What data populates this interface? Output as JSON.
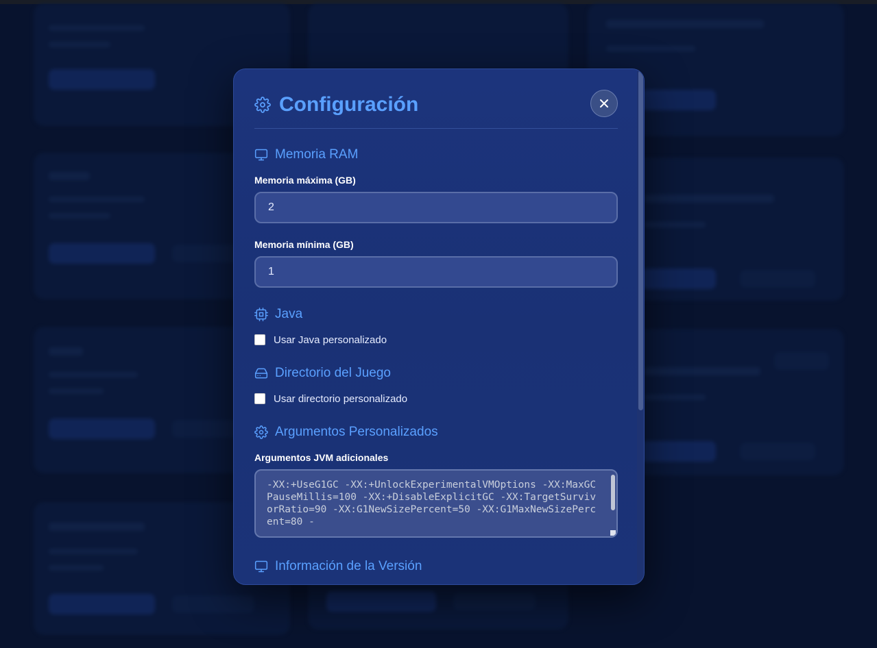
{
  "modal": {
    "title": "Configuración",
    "title_icon": "gear-icon",
    "close_icon": "close-icon"
  },
  "sections": {
    "ram": {
      "title": "Memoria RAM",
      "icon": "monitor-icon"
    },
    "java": {
      "title": "Java",
      "icon": "cpu-icon"
    },
    "gamedir": {
      "title": "Directorio del Juego",
      "icon": "hard-drive-icon"
    },
    "args": {
      "title": "Argumentos Personalizados",
      "icon": "gear-icon"
    },
    "version": {
      "title": "Información de la Versión",
      "icon": "monitor-icon"
    }
  },
  "fields": {
    "max_memory": {
      "label": "Memoria máxima (GB)",
      "value": "2"
    },
    "min_memory": {
      "label": "Memoria mínima (GB)",
      "value": "1"
    },
    "custom_java": {
      "label": "Usar Java personalizado",
      "checked": false
    },
    "custom_dir": {
      "label": "Usar directorio personalizado",
      "checked": false
    },
    "jvm_args": {
      "label": "Argumentos JVM adicionales",
      "value": "-XX:+UseG1GC -XX:+UnlockExperimentalVMOptions -XX:MaxGCPauseMillis=100 -XX:+DisableExplicitGC -XX:TargetSurvivorRatio=90 -XX:G1NewSizePercent=50 -XX:G1MaxNewSizePercent=80 -"
    }
  },
  "colors": {
    "accent": "#5aa0ff",
    "modal_bg": "#1c347c",
    "input_bg": "#334990",
    "page_bg": "#0b1a3c"
  }
}
